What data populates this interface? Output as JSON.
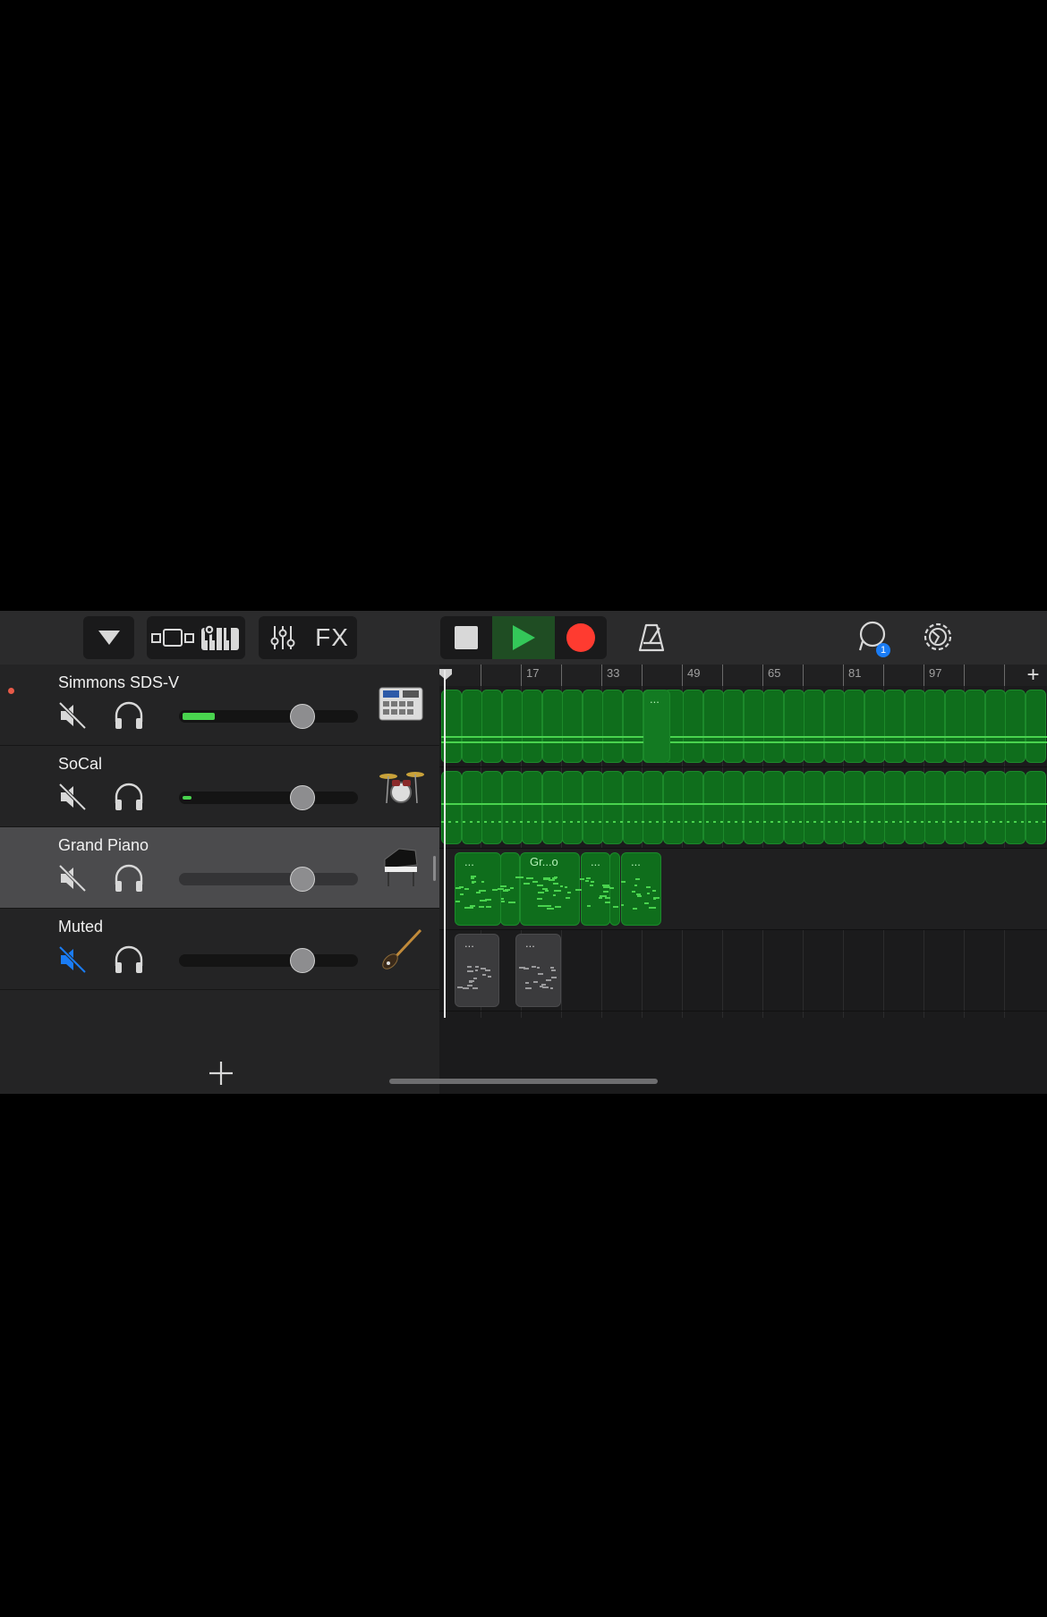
{
  "toolbar": {
    "fx_label": "FX",
    "notification_count": "1"
  },
  "ruler": {
    "bar_labels": [
      "17",
      "33",
      "49",
      "65",
      "81",
      "97"
    ],
    "add_section_label": "+"
  },
  "tracks": [
    {
      "name": "Simmons SDS-V",
      "instrument": "drum-machine-icon",
      "muted": false,
      "level_meter": 0.18,
      "volume": 0.7,
      "armed": true
    },
    {
      "name": "SoCal",
      "instrument": "drum-kit-icon",
      "muted": false,
      "level_meter": 0.05,
      "volume": 0.7,
      "armed": false
    },
    {
      "name": "Grand Piano",
      "instrument": "grand-piano-icon",
      "muted": false,
      "level_meter": 0,
      "volume": 0.7,
      "selected": true
    },
    {
      "name": "Muted",
      "instrument": "bass-guitar-icon",
      "muted": true,
      "level_meter": 0,
      "volume": 0.7
    }
  ],
  "regions": {
    "simmons_label": "...",
    "piano_labels": [
      "...",
      "Gr...o",
      "...",
      "..."
    ],
    "muted_labels": [
      "...",
      "..."
    ]
  },
  "colors": {
    "region_green": "#0f6e1c",
    "record_red": "#ff3b30",
    "play_green": "#34c759",
    "mute_active_blue": "#1a7cf5"
  }
}
